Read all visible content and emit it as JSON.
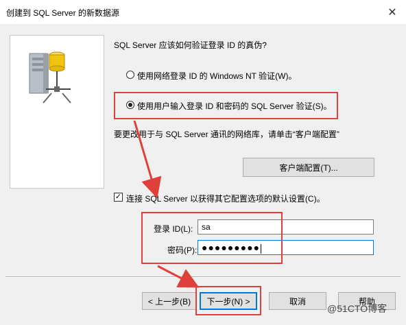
{
  "window": {
    "title": "创建到 SQL Server 的新数据源",
    "close_label": "✕"
  },
  "question": "SQL Server 应该如何验证登录 ID 的真伪?",
  "auth_options": [
    {
      "label": "使用网络登录 ID 的 Windows NT 验证(W)。",
      "selected": false
    },
    {
      "label": "使用用户输入登录 ID 和密码的 SQL Server 验证(S)。",
      "selected": true
    }
  ],
  "network_hint": "要更改用于与 SQL Server 通讯的网络库，请单击“客户端配置”",
  "client_config_button": "客户端配置(T)...",
  "connect_checkbox": {
    "label": "连接 SQL Server 以获得其它配置选项的默认设置(C)。",
    "checked": true
  },
  "login": {
    "id_label": "登录 ID(L):",
    "id_value": "sa",
    "password_label": "密码(P):",
    "password_value": "●●●●●●●●●"
  },
  "buttons": {
    "back": "< 上一步(B)",
    "next": "下一步(N) >",
    "cancel": "取消",
    "help": "帮助"
  },
  "watermark": "@51CTO博客",
  "colors": {
    "highlight": "#e0403a",
    "focus": "#0078d7"
  }
}
